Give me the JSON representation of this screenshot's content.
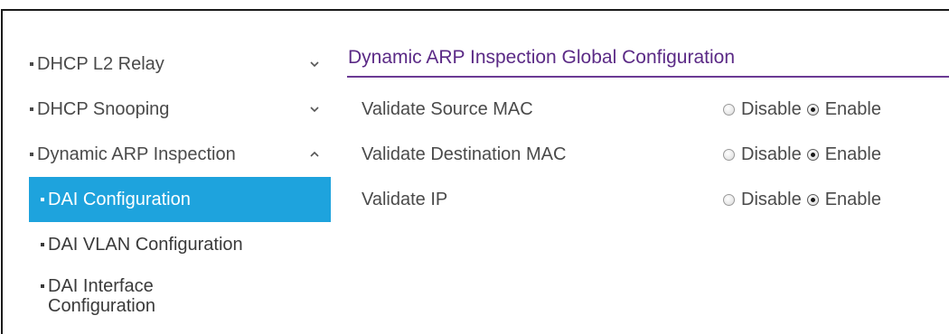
{
  "sidebar": {
    "items": [
      {
        "label": "DHCP L2 Relay",
        "chevron": "down"
      },
      {
        "label": "DHCP Snooping",
        "chevron": "down"
      },
      {
        "label": "Dynamic ARP Inspection",
        "chevron": "up"
      },
      {
        "label": "DAI Configuration",
        "active": true
      },
      {
        "label": "DAI VLAN Configuration"
      },
      {
        "label": "DAI Interface Configuration"
      }
    ]
  },
  "panel": {
    "title": "Dynamic ARP Inspection Global Configuration",
    "rows": [
      {
        "label": "Validate Source MAC",
        "disable_label": "Disable",
        "enable_label": "Enable",
        "selected": "Enable"
      },
      {
        "label": "Validate Destination MAC",
        "disable_label": "Disable",
        "enable_label": "Enable",
        "selected": "Enable"
      },
      {
        "label": "Validate IP",
        "disable_label": "Disable",
        "enable_label": "Enable",
        "selected": "Enable"
      }
    ]
  },
  "colors": {
    "active_item_bg": "#1ea3dd",
    "title_color": "#5b2a86",
    "title_underline": "#6b3a94"
  }
}
